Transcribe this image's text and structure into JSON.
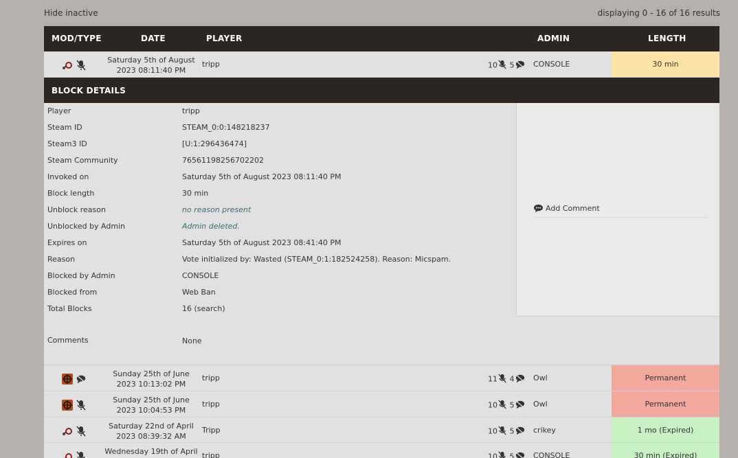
{
  "top": {
    "hide_inactive": "Hide inactive",
    "displaying": "displaying 0 - 16 of 16 results"
  },
  "columns": {
    "mod_type": "MOD/TYPE",
    "date": "DATE",
    "player": "PLAYER",
    "admin": "ADMIN",
    "length": "LENGTH"
  },
  "rows": [
    {
      "mod_icon": "steam-icon",
      "type_icon": "mic-muted-icon",
      "date_line1": "Saturday 5th of August",
      "date_line2": "2023 08:11:40 PM",
      "player": "tripp",
      "mutes": "10",
      "gags": "5",
      "admin": "CONSOLE",
      "length": "30 min",
      "length_color": "#fde3a6"
    },
    {
      "mod_icon": "tf2-icon",
      "type_icon": "chat-blocked-icon",
      "date_line1": "Sunday 25th of June",
      "date_line2": "2023 10:13:02 PM",
      "player": "tripp",
      "mutes": "11",
      "gags": "4",
      "admin": "Owl",
      "length": "Permanent",
      "length_color": "#f2a89a"
    },
    {
      "mod_icon": "tf2-icon",
      "type_icon": "mic-muted-icon",
      "date_line1": "Sunday 25th of June",
      "date_line2": "2023 10:04:53 PM",
      "player": "tripp",
      "mutes": "10",
      "gags": "5",
      "admin": "Owl",
      "length": "Permanent",
      "length_color": "#f2a89a"
    },
    {
      "mod_icon": "steam-icon",
      "type_icon": "mic-muted-icon",
      "date_line1": "Saturday 22nd of April",
      "date_line2": "2023 08:39:32 AM",
      "player": "Tripp",
      "mutes": "10",
      "gags": "5",
      "admin": "crikey",
      "length": "1 mo (Expired)",
      "length_color": "#c7f1c3"
    },
    {
      "mod_icon": "steam-icon",
      "type_icon": "mic-muted-icon",
      "date_line1": "Wednesday 19th of April",
      "date_line2": "",
      "player": "tripp",
      "mutes": "10",
      "gags": "5",
      "admin": "CONSOLE",
      "length": "30 min (Expired)",
      "length_color": "#c7f1c3"
    }
  ],
  "details": {
    "title": "BLOCK DETAILS",
    "fields": [
      {
        "label": "Player",
        "value": "tripp"
      },
      {
        "label": "Steam ID",
        "value": "STEAM_0:0:148218237"
      },
      {
        "label": "Steam3 ID",
        "value": "[U:1:296436474]"
      },
      {
        "label": "Steam Community",
        "value": "76561198256702202"
      },
      {
        "label": "Invoked on",
        "value": "Saturday 5th of August 2023 08:11:40 PM"
      },
      {
        "label": "Block length",
        "value": "30 min"
      },
      {
        "label": "Unblock reason",
        "value": "no reason present"
      },
      {
        "label": "Unblocked by Admin",
        "value": "Admin deleted."
      },
      {
        "label": "Expires on",
        "value": "Saturday 5th of August 2023 08:41:40 PM"
      },
      {
        "label": "Reason",
        "value": "Vote initialized by: Wasted (STEAM_0:1:182524258). Reason: Micspam."
      },
      {
        "label": "Blocked by Admin",
        "value": "CONSOLE"
      },
      {
        "label": "Blocked from",
        "value": "Web Ban"
      },
      {
        "label": "Total Blocks",
        "value": "16 (search)"
      },
      {
        "label": "Comments",
        "value": "None"
      }
    ],
    "add_comment": "Add Comment"
  },
  "colors": {
    "header_bg": "#2b2622",
    "row_bg": "#e1e1e1",
    "page_bg": "#b5b0ac"
  }
}
